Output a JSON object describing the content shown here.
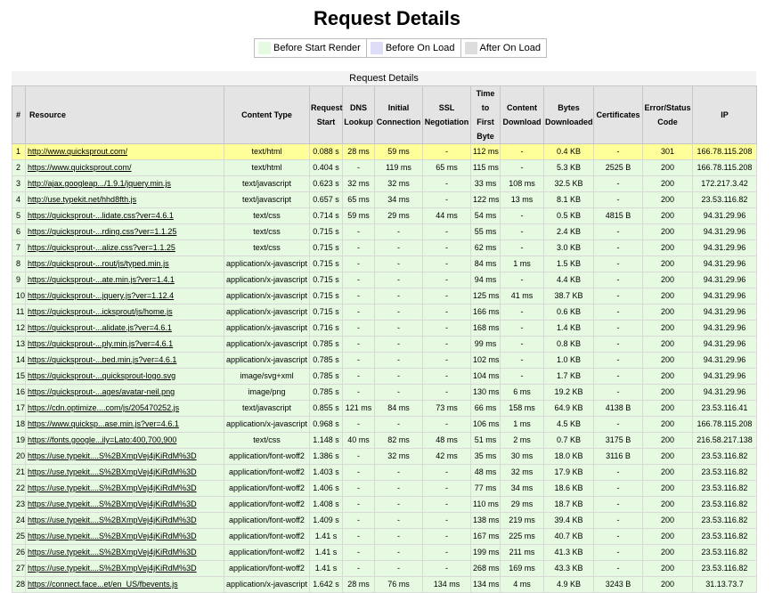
{
  "title": "Request Details",
  "caption": "Request Details",
  "legend": [
    {
      "label": "Before Start Render",
      "color": "#e6f9e1"
    },
    {
      "label": "Before On Load",
      "color": "#ddddf7"
    },
    {
      "label": "After On Load",
      "color": "#ddd"
    }
  ],
  "colors": {
    "highlight_row": "#ffff99",
    "before_start_render": "#e6f9e1"
  },
  "columns": [
    "#",
    "Resource",
    "Content Type",
    "Request Start",
    "DNS Lookup",
    "Initial Connection",
    "SSL Negotiation",
    "Time to First Byte",
    "Content Download",
    "Bytes Downloaded",
    "Certificates",
    "Error/Status Code",
    "IP"
  ],
  "rows": [
    [
      "1",
      "http://www.quicksprout.com/",
      "text/html",
      "0.088 s",
      "28 ms",
      "59 ms",
      "-",
      "112 ms",
      "-",
      "0.4 KB",
      "-",
      "301",
      "166.78.115.208"
    ],
    [
      "2",
      "https://www.quicksprout.com/",
      "text/html",
      "0.404 s",
      "-",
      "119 ms",
      "65 ms",
      "115 ms",
      "-",
      "5.3 KB",
      "2525 B",
      "200",
      "166.78.115.208"
    ],
    [
      "3",
      "http://ajax.googleap.../1.9.1/jquery.min.js",
      "text/javascript",
      "0.623 s",
      "32 ms",
      "32 ms",
      "-",
      "33 ms",
      "108 ms",
      "32.5 KB",
      "-",
      "200",
      "172.217.3.42"
    ],
    [
      "4",
      "http://use.typekit.net/hhd8fth.js",
      "text/javascript",
      "0.657 s",
      "65 ms",
      "34 ms",
      "-",
      "122 ms",
      "13 ms",
      "8.1 KB",
      "-",
      "200",
      "23.53.116.82"
    ],
    [
      "5",
      "https://quicksprout-...lidate.css?ver=4.6.1",
      "text/css",
      "0.714 s",
      "59 ms",
      "29 ms",
      "44 ms",
      "54 ms",
      "-",
      "0.5 KB",
      "4815 B",
      "200",
      "94.31.29.96"
    ],
    [
      "6",
      "https://quicksprout-...rding.css?ver=1.1.25",
      "text/css",
      "0.715 s",
      "-",
      "-",
      "-",
      "55 ms",
      "-",
      "2.4 KB",
      "-",
      "200",
      "94.31.29.96"
    ],
    [
      "7",
      "https://quicksprout-...alize.css?ver=1.1.25",
      "text/css",
      "0.715 s",
      "-",
      "-",
      "-",
      "62 ms",
      "-",
      "3.0 KB",
      "-",
      "200",
      "94.31.29.96"
    ],
    [
      "8",
      "https://quicksprout-...rout/js/typed.min.js",
      "application/x-javascript",
      "0.715 s",
      "-",
      "-",
      "-",
      "84 ms",
      "1 ms",
      "1.5 KB",
      "-",
      "200",
      "94.31.29.96"
    ],
    [
      "9",
      "https://quicksprout-...ate.min.js?ver=1.4.1",
      "application/x-javascript",
      "0.715 s",
      "-",
      "-",
      "-",
      "94 ms",
      "-",
      "4.4 KB",
      "-",
      "200",
      "94.31.29.96"
    ],
    [
      "10",
      "https://quicksprout-...jquery.js?ver=1.12.4",
      "application/x-javascript",
      "0.715 s",
      "-",
      "-",
      "-",
      "125 ms",
      "41 ms",
      "38.7 KB",
      "-",
      "200",
      "94.31.29.96"
    ],
    [
      "11",
      "https://quicksprout-...icksprout/js/home.js",
      "application/x-javascript",
      "0.715 s",
      "-",
      "-",
      "-",
      "166 ms",
      "-",
      "0.6 KB",
      "-",
      "200",
      "94.31.29.96"
    ],
    [
      "12",
      "https://quicksprout-...alidate.js?ver=4.6.1",
      "application/x-javascript",
      "0.716 s",
      "-",
      "-",
      "-",
      "168 ms",
      "-",
      "1.4 KB",
      "-",
      "200",
      "94.31.29.96"
    ],
    [
      "13",
      "https://quicksprout-...ply.min.js?ver=4.6.1",
      "application/x-javascript",
      "0.785 s",
      "-",
      "-",
      "-",
      "99 ms",
      "-",
      "0.8 KB",
      "-",
      "200",
      "94.31.29.96"
    ],
    [
      "14",
      "https://quicksprout-...bed.min.js?ver=4.6.1",
      "application/x-javascript",
      "0.785 s",
      "-",
      "-",
      "-",
      "102 ms",
      "-",
      "1.0 KB",
      "-",
      "200",
      "94.31.29.96"
    ],
    [
      "15",
      "https://quicksprout-...quicksprout-logo.svg",
      "image/svg+xml",
      "0.785 s",
      "-",
      "-",
      "-",
      "104 ms",
      "-",
      "1.7 KB",
      "-",
      "200",
      "94.31.29.96"
    ],
    [
      "16",
      "https://quicksprout-...ages/avatar-neil.png",
      "image/png",
      "0.785 s",
      "-",
      "-",
      "-",
      "130 ms",
      "6 ms",
      "19.2 KB",
      "-",
      "200",
      "94.31.29.96"
    ],
    [
      "17",
      "https://cdn.optimize....com/js/205470252.js",
      "text/javascript",
      "0.855 s",
      "121 ms",
      "84 ms",
      "73 ms",
      "66 ms",
      "158 ms",
      "64.9 KB",
      "4138 B",
      "200",
      "23.53.116.41"
    ],
    [
      "18",
      "https://www.quicksp...ase.min.js?ver=4.6.1",
      "application/x-javascript",
      "0.968 s",
      "-",
      "-",
      "-",
      "106 ms",
      "1 ms",
      "4.5 KB",
      "-",
      "200",
      "166.78.115.208"
    ],
    [
      "19",
      "https://fonts.google...ily=Lato:400,700,900",
      "text/css",
      "1.148 s",
      "40 ms",
      "82 ms",
      "48 ms",
      "51 ms",
      "2 ms",
      "0.7 KB",
      "3175 B",
      "200",
      "216.58.217.138"
    ],
    [
      "20",
      "https://use.typekit....S%2BXmpVej4jKiRdM%3D",
      "application/font-woff2",
      "1.386 s",
      "-",
      "32 ms",
      "42 ms",
      "35 ms",
      "30 ms",
      "18.0 KB",
      "3116 B",
      "200",
      "23.53.116.82"
    ],
    [
      "21",
      "https://use.typekit....S%2BXmpVej4jKiRdM%3D",
      "application/font-woff2",
      "1.403 s",
      "-",
      "-",
      "-",
      "48 ms",
      "32 ms",
      "17.9 KB",
      "-",
      "200",
      "23.53.116.82"
    ],
    [
      "22",
      "https://use.typekit....S%2BXmpVej4jKiRdM%3D",
      "application/font-woff2",
      "1.406 s",
      "-",
      "-",
      "-",
      "77 ms",
      "34 ms",
      "18.6 KB",
      "-",
      "200",
      "23.53.116.82"
    ],
    [
      "23",
      "https://use.typekit....S%2BXmpVej4jKiRdM%3D",
      "application/font-woff2",
      "1.408 s",
      "-",
      "-",
      "-",
      "110 ms",
      "29 ms",
      "18.7 KB",
      "-",
      "200",
      "23.53.116.82"
    ],
    [
      "24",
      "https://use.typekit....S%2BXmpVej4jKiRdM%3D",
      "application/font-woff2",
      "1.409 s",
      "-",
      "-",
      "-",
      "138 ms",
      "219 ms",
      "39.4 KB",
      "-",
      "200",
      "23.53.116.82"
    ],
    [
      "25",
      "https://use.typekit....S%2BXmpVej4jKiRdM%3D",
      "application/font-woff2",
      "1.41 s",
      "-",
      "-",
      "-",
      "167 ms",
      "225 ms",
      "40.7 KB",
      "-",
      "200",
      "23.53.116.82"
    ],
    [
      "26",
      "https://use.typekit....S%2BXmpVej4jKiRdM%3D",
      "application/font-woff2",
      "1.41 s",
      "-",
      "-",
      "-",
      "199 ms",
      "211 ms",
      "41.3 KB",
      "-",
      "200",
      "23.53.116.82"
    ],
    [
      "27",
      "https://use.typekit....S%2BXmpVej4jKiRdM%3D",
      "application/font-woff2",
      "1.41 s",
      "-",
      "-",
      "-",
      "268 ms",
      "169 ms",
      "43.3 KB",
      "-",
      "200",
      "23.53.116.82"
    ],
    [
      "28",
      "https://connect.face...et/en_US/fbevents.js",
      "application/x-javascript",
      "1.642 s",
      "28 ms",
      "76 ms",
      "134 ms",
      "134 ms",
      "4 ms",
      "4.9 KB",
      "3243 B",
      "200",
      "31.13.73.7"
    ]
  ]
}
